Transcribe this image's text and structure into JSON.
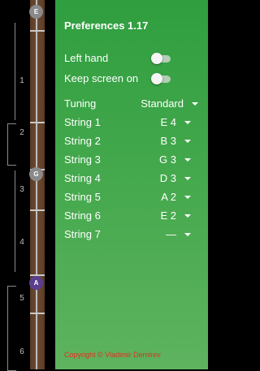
{
  "neck": {
    "fret_numbers": [
      "1",
      "2",
      "3",
      "4",
      "5",
      "6"
    ],
    "markers": [
      {
        "note": "E",
        "color": "#8a8a8a"
      },
      {
        "note": "G",
        "color": "#8a8a8a"
      },
      {
        "note": "A",
        "color": "#5b3f8f"
      }
    ]
  },
  "preferences": {
    "title": "Preferences 1.17",
    "left_hand": {
      "label": "Left hand",
      "enabled": false
    },
    "keep_screen_on": {
      "label": "Keep screen on",
      "enabled": false
    },
    "tuning": {
      "label": "Tuning",
      "value": "Standard"
    },
    "strings": [
      {
        "label": "String 1",
        "value": "E 4"
      },
      {
        "label": "String 2",
        "value": "B 3"
      },
      {
        "label": "String 3",
        "value": "G 3"
      },
      {
        "label": "String 4",
        "value": "D 3"
      },
      {
        "label": "String 5",
        "value": "A 2"
      },
      {
        "label": "String 6",
        "value": "E 2"
      },
      {
        "label": "String 7",
        "value": "—"
      }
    ],
    "copyright": "Copyright © Vladimir Demirev"
  }
}
